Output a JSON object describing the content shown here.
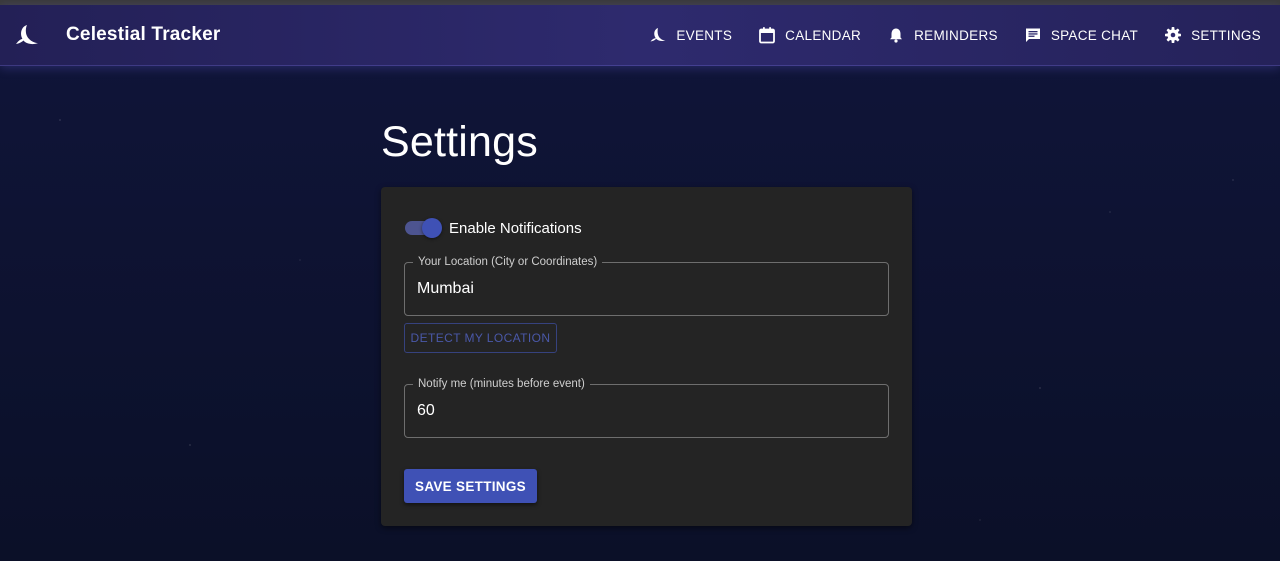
{
  "app": {
    "title": "Celestial Tracker",
    "logo_icon": "moon-icon"
  },
  "nav": {
    "items": [
      {
        "label": "EVENTS",
        "icon": "moon-icon"
      },
      {
        "label": "CALENDAR",
        "icon": "calendar-icon"
      },
      {
        "label": "REMINDERS",
        "icon": "bell-icon"
      },
      {
        "label": "SPACE CHAT",
        "icon": "chat-icon"
      },
      {
        "label": "SETTINGS",
        "icon": "gear-icon"
      }
    ]
  },
  "page": {
    "title": "Settings"
  },
  "settings": {
    "notifications": {
      "label": "Enable Notifications",
      "enabled": true
    },
    "location": {
      "label": "Your Location (City or Coordinates)",
      "value": "Mumbai"
    },
    "detect_button": "DETECT MY LOCATION",
    "notify": {
      "label": "Notify me (minutes before event)",
      "value": "60"
    },
    "save_button": "SAVE SETTINGS"
  },
  "colors": {
    "primary": "#3f51b5",
    "appbar": "#2e2a6e",
    "background": "#0b1028",
    "card": "#242424"
  }
}
